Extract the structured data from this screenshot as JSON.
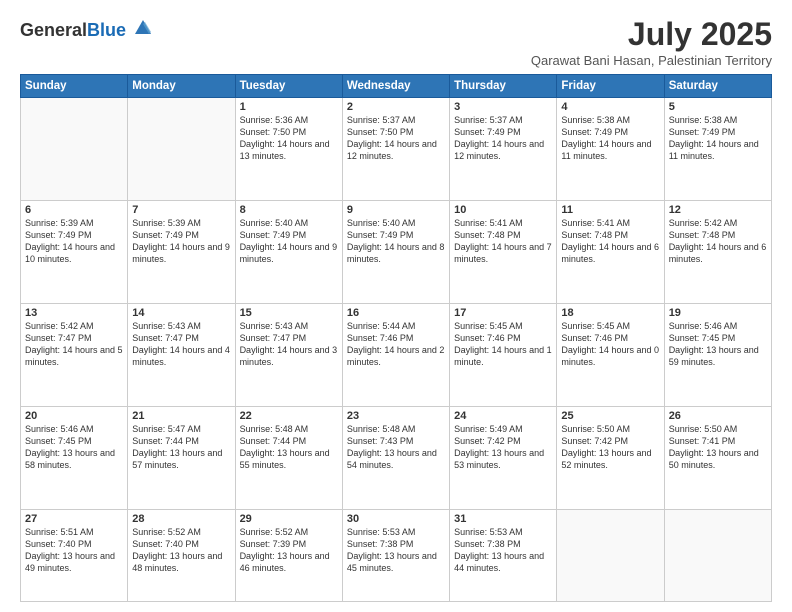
{
  "logo": {
    "text1": "General",
    "text2": "Blue"
  },
  "header": {
    "month_year": "July 2025",
    "location": "Qarawat Bani Hasan, Palestinian Territory"
  },
  "days_of_week": [
    "Sunday",
    "Monday",
    "Tuesday",
    "Wednesday",
    "Thursday",
    "Friday",
    "Saturday"
  ],
  "weeks": [
    [
      {
        "day": "",
        "sunrise": "",
        "sunset": "",
        "daylight": "",
        "empty": true
      },
      {
        "day": "",
        "sunrise": "",
        "sunset": "",
        "daylight": "",
        "empty": true
      },
      {
        "day": "1",
        "sunrise": "Sunrise: 5:36 AM",
        "sunset": "Sunset: 7:50 PM",
        "daylight": "Daylight: 14 hours and 13 minutes."
      },
      {
        "day": "2",
        "sunrise": "Sunrise: 5:37 AM",
        "sunset": "Sunset: 7:50 PM",
        "daylight": "Daylight: 14 hours and 12 minutes."
      },
      {
        "day": "3",
        "sunrise": "Sunrise: 5:37 AM",
        "sunset": "Sunset: 7:49 PM",
        "daylight": "Daylight: 14 hours and 12 minutes."
      },
      {
        "day": "4",
        "sunrise": "Sunrise: 5:38 AM",
        "sunset": "Sunset: 7:49 PM",
        "daylight": "Daylight: 14 hours and 11 minutes."
      },
      {
        "day": "5",
        "sunrise": "Sunrise: 5:38 AM",
        "sunset": "Sunset: 7:49 PM",
        "daylight": "Daylight: 14 hours and 11 minutes."
      }
    ],
    [
      {
        "day": "6",
        "sunrise": "Sunrise: 5:39 AM",
        "sunset": "Sunset: 7:49 PM",
        "daylight": "Daylight: 14 hours and 10 minutes."
      },
      {
        "day": "7",
        "sunrise": "Sunrise: 5:39 AM",
        "sunset": "Sunset: 7:49 PM",
        "daylight": "Daylight: 14 hours and 9 minutes."
      },
      {
        "day": "8",
        "sunrise": "Sunrise: 5:40 AM",
        "sunset": "Sunset: 7:49 PM",
        "daylight": "Daylight: 14 hours and 9 minutes."
      },
      {
        "day": "9",
        "sunrise": "Sunrise: 5:40 AM",
        "sunset": "Sunset: 7:49 PM",
        "daylight": "Daylight: 14 hours and 8 minutes."
      },
      {
        "day": "10",
        "sunrise": "Sunrise: 5:41 AM",
        "sunset": "Sunset: 7:48 PM",
        "daylight": "Daylight: 14 hours and 7 minutes."
      },
      {
        "day": "11",
        "sunrise": "Sunrise: 5:41 AM",
        "sunset": "Sunset: 7:48 PM",
        "daylight": "Daylight: 14 hours and 6 minutes."
      },
      {
        "day": "12",
        "sunrise": "Sunrise: 5:42 AM",
        "sunset": "Sunset: 7:48 PM",
        "daylight": "Daylight: 14 hours and 6 minutes."
      }
    ],
    [
      {
        "day": "13",
        "sunrise": "Sunrise: 5:42 AM",
        "sunset": "Sunset: 7:47 PM",
        "daylight": "Daylight: 14 hours and 5 minutes."
      },
      {
        "day": "14",
        "sunrise": "Sunrise: 5:43 AM",
        "sunset": "Sunset: 7:47 PM",
        "daylight": "Daylight: 14 hours and 4 minutes."
      },
      {
        "day": "15",
        "sunrise": "Sunrise: 5:43 AM",
        "sunset": "Sunset: 7:47 PM",
        "daylight": "Daylight: 14 hours and 3 minutes."
      },
      {
        "day": "16",
        "sunrise": "Sunrise: 5:44 AM",
        "sunset": "Sunset: 7:46 PM",
        "daylight": "Daylight: 14 hours and 2 minutes."
      },
      {
        "day": "17",
        "sunrise": "Sunrise: 5:45 AM",
        "sunset": "Sunset: 7:46 PM",
        "daylight": "Daylight: 14 hours and 1 minute."
      },
      {
        "day": "18",
        "sunrise": "Sunrise: 5:45 AM",
        "sunset": "Sunset: 7:46 PM",
        "daylight": "Daylight: 14 hours and 0 minutes."
      },
      {
        "day": "19",
        "sunrise": "Sunrise: 5:46 AM",
        "sunset": "Sunset: 7:45 PM",
        "daylight": "Daylight: 13 hours and 59 minutes."
      }
    ],
    [
      {
        "day": "20",
        "sunrise": "Sunrise: 5:46 AM",
        "sunset": "Sunset: 7:45 PM",
        "daylight": "Daylight: 13 hours and 58 minutes."
      },
      {
        "day": "21",
        "sunrise": "Sunrise: 5:47 AM",
        "sunset": "Sunset: 7:44 PM",
        "daylight": "Daylight: 13 hours and 57 minutes."
      },
      {
        "day": "22",
        "sunrise": "Sunrise: 5:48 AM",
        "sunset": "Sunset: 7:44 PM",
        "daylight": "Daylight: 13 hours and 55 minutes."
      },
      {
        "day": "23",
        "sunrise": "Sunrise: 5:48 AM",
        "sunset": "Sunset: 7:43 PM",
        "daylight": "Daylight: 13 hours and 54 minutes."
      },
      {
        "day": "24",
        "sunrise": "Sunrise: 5:49 AM",
        "sunset": "Sunset: 7:42 PM",
        "daylight": "Daylight: 13 hours and 53 minutes."
      },
      {
        "day": "25",
        "sunrise": "Sunrise: 5:50 AM",
        "sunset": "Sunset: 7:42 PM",
        "daylight": "Daylight: 13 hours and 52 minutes."
      },
      {
        "day": "26",
        "sunrise": "Sunrise: 5:50 AM",
        "sunset": "Sunset: 7:41 PM",
        "daylight": "Daylight: 13 hours and 50 minutes."
      }
    ],
    [
      {
        "day": "27",
        "sunrise": "Sunrise: 5:51 AM",
        "sunset": "Sunset: 7:40 PM",
        "daylight": "Daylight: 13 hours and 49 minutes."
      },
      {
        "day": "28",
        "sunrise": "Sunrise: 5:52 AM",
        "sunset": "Sunset: 7:40 PM",
        "daylight": "Daylight: 13 hours and 48 minutes."
      },
      {
        "day": "29",
        "sunrise": "Sunrise: 5:52 AM",
        "sunset": "Sunset: 7:39 PM",
        "daylight": "Daylight: 13 hours and 46 minutes."
      },
      {
        "day": "30",
        "sunrise": "Sunrise: 5:53 AM",
        "sunset": "Sunset: 7:38 PM",
        "daylight": "Daylight: 13 hours and 45 minutes."
      },
      {
        "day": "31",
        "sunrise": "Sunrise: 5:53 AM",
        "sunset": "Sunset: 7:38 PM",
        "daylight": "Daylight: 13 hours and 44 minutes."
      },
      {
        "day": "",
        "sunrise": "",
        "sunset": "",
        "daylight": "",
        "empty": true
      },
      {
        "day": "",
        "sunrise": "",
        "sunset": "",
        "daylight": "",
        "empty": true
      }
    ]
  ]
}
